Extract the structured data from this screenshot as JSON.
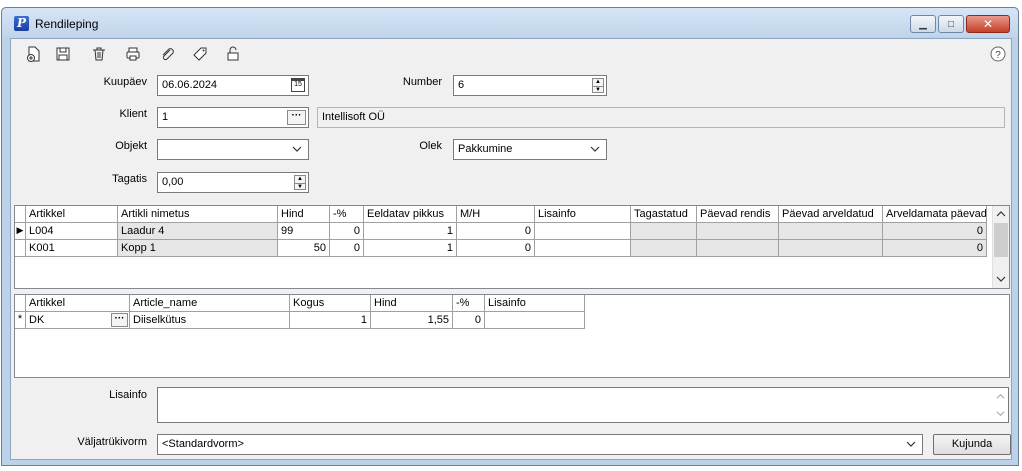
{
  "window": {
    "title": "Rendileping"
  },
  "toolbar": {
    "icons": [
      "new-document-icon",
      "save-icon",
      "delete-icon",
      "print-icon",
      "attach-icon",
      "tag-icon",
      "lock-icon"
    ],
    "help": "?"
  },
  "form": {
    "kuupaev": {
      "label": "Kuupäev",
      "value": "06.06.2024"
    },
    "number": {
      "label": "Number",
      "value": "6"
    },
    "klient": {
      "label": "Klient",
      "value": "1",
      "name": "Intellisoft OÜ"
    },
    "objekt": {
      "label": "Objekt",
      "value": ""
    },
    "olek": {
      "label": "Olek",
      "value": "Pakkumine"
    },
    "tagatis": {
      "label": "Tagatis",
      "value": "0,00"
    }
  },
  "grid1": {
    "columns": [
      "Artikkel",
      "Artikli nimetus",
      "Hind",
      "-%",
      "Eeldatav pikkus",
      "M/H",
      "Lisainfo",
      "Tagastatud",
      "Päevad rendis",
      "Päevad arveldatud",
      "Arveldamata päevad"
    ],
    "rows": [
      [
        "L004",
        "Laadur 4",
        "99",
        "0",
        "1",
        "0",
        "",
        "",
        "",
        "",
        "0"
      ],
      [
        "K001",
        "Kopp 1",
        "50",
        "0",
        "1",
        "0",
        "",
        "",
        "",
        "",
        "0"
      ]
    ]
  },
  "grid2": {
    "columns": [
      "Artikkel",
      "Article_name",
      "Kogus",
      "Hind",
      "-%",
      "Lisainfo"
    ],
    "rows": [
      [
        "DK",
        "Diiselkütus",
        "1",
        "1,55",
        "0",
        ""
      ]
    ],
    "new_row_marker": "*"
  },
  "lisainfo": {
    "label": "Lisainfo",
    "value": ""
  },
  "valjatrukivorm": {
    "label": "Väljatrükivorm",
    "value": "<Standardvorm>"
  },
  "kujunda": {
    "label": "Kujunda"
  }
}
